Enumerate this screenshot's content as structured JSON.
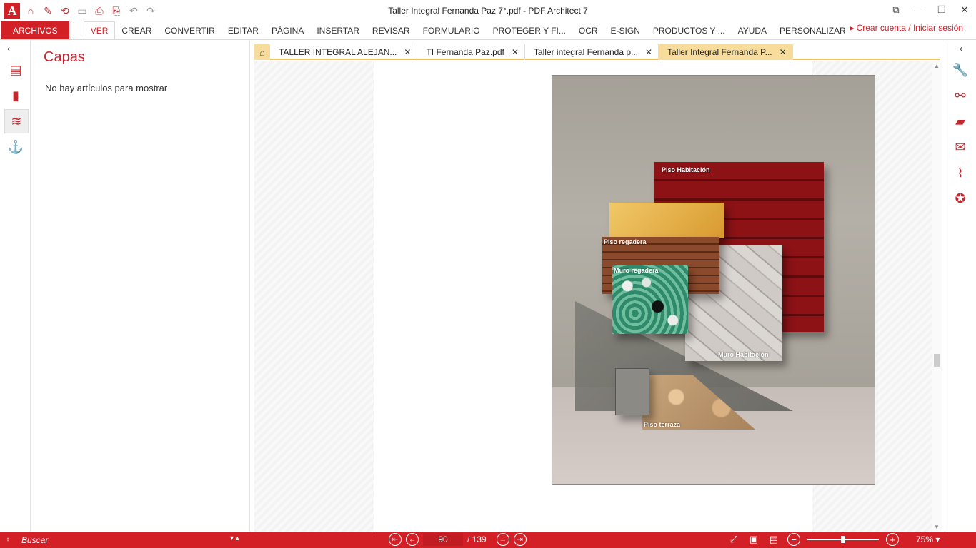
{
  "window": {
    "title": "Taller Integral Fernanda Paz 7°.pdf   -   PDF Architect 7",
    "logo_glyph": "A",
    "controls": {
      "restore_small": "⧉",
      "minimize": "—",
      "maximize": "❐",
      "close": "✕"
    }
  },
  "quick_access": [
    {
      "name": "home-icon",
      "glyph": "⌂"
    },
    {
      "name": "edit-icon",
      "glyph": "✎"
    },
    {
      "name": "convert-icon",
      "glyph": "⟲"
    },
    {
      "name": "save-icon",
      "glyph": "▭"
    },
    {
      "name": "print-icon",
      "glyph": "⎙"
    },
    {
      "name": "print-preview-icon",
      "glyph": "⎘"
    },
    {
      "name": "undo-icon",
      "glyph": "↶"
    },
    {
      "name": "redo-icon",
      "glyph": "↷"
    }
  ],
  "ribbon": {
    "file_tab": "ARCHIVOS",
    "tabs": [
      "VER",
      "CREAR",
      "CONVERTIR",
      "EDITAR",
      "PÁGINA",
      "INSERTAR",
      "REVISAR",
      "FORMULARIO",
      "PROTEGER Y FI...",
      "OCR",
      "E-SIGN",
      "PRODUCTOS Y ...",
      "AYUDA",
      "PERSONALIZAR"
    ],
    "active_tab": "VER",
    "signin": "Crear cuenta / Iniciar sesión"
  },
  "left_strip": {
    "collapse_glyph": "‹",
    "items": [
      {
        "name": "page-thumbnails-icon",
        "glyph": "▤"
      },
      {
        "name": "bookmarks-icon",
        "glyph": "▮"
      },
      {
        "name": "layers-icon",
        "glyph": "≋",
        "selected": true
      },
      {
        "name": "anchor-icon",
        "glyph": "⚓"
      }
    ]
  },
  "layers_panel": {
    "title": "Capas",
    "empty_text": "No hay artículos para mostrar"
  },
  "doc_tabs": [
    {
      "label": "TALLER INTEGRAL ALEJAN...",
      "active": false
    },
    {
      "label": "TI Fernanda Paz.pdf",
      "active": false
    },
    {
      "label": "Taller integral Fernanda p...",
      "active": false
    },
    {
      "label": "Taller Integral Fernanda P...",
      "active": true
    }
  ],
  "doc_tab_close": "✕",
  "home_glyph": "⌂",
  "board": {
    "labels": {
      "piso_habitacion": "Piso Habitación",
      "piso_regadera": "Piso regadera",
      "muro_regadera": "Muro regadera",
      "muro_habitacion": "Muro Habitación",
      "piso_terraza": "Piso terraza"
    }
  },
  "statusbar": {
    "search_placeholder": "Buscar",
    "current_page": "90",
    "total_pages": "/ 139",
    "zoom": "75%",
    "zoom_fraction": 0.5,
    "glyphs": {
      "grip": "⁞",
      "first": "⇤",
      "prev": "←",
      "next": "→",
      "last": "⇥",
      "fit": "⤢",
      "actual": "▣",
      "single": "▤",
      "minus": "−",
      "plus": "+",
      "dropdown": "▾"
    }
  },
  "right_strip": {
    "collapse_glyph": "‹",
    "items": [
      {
        "name": "wrench-icon",
        "glyph": "🔧"
      },
      {
        "name": "binoculars-icon",
        "glyph": "⚯"
      },
      {
        "name": "folder-icon",
        "glyph": "▰"
      },
      {
        "name": "comment-icon",
        "glyph": "✉"
      },
      {
        "name": "paperclip-icon",
        "glyph": "⌇"
      },
      {
        "name": "certificate-icon",
        "glyph": "✪"
      }
    ]
  },
  "colors": {
    "accent": "#d32027",
    "tab_highlight": "#f7dc9c"
  }
}
